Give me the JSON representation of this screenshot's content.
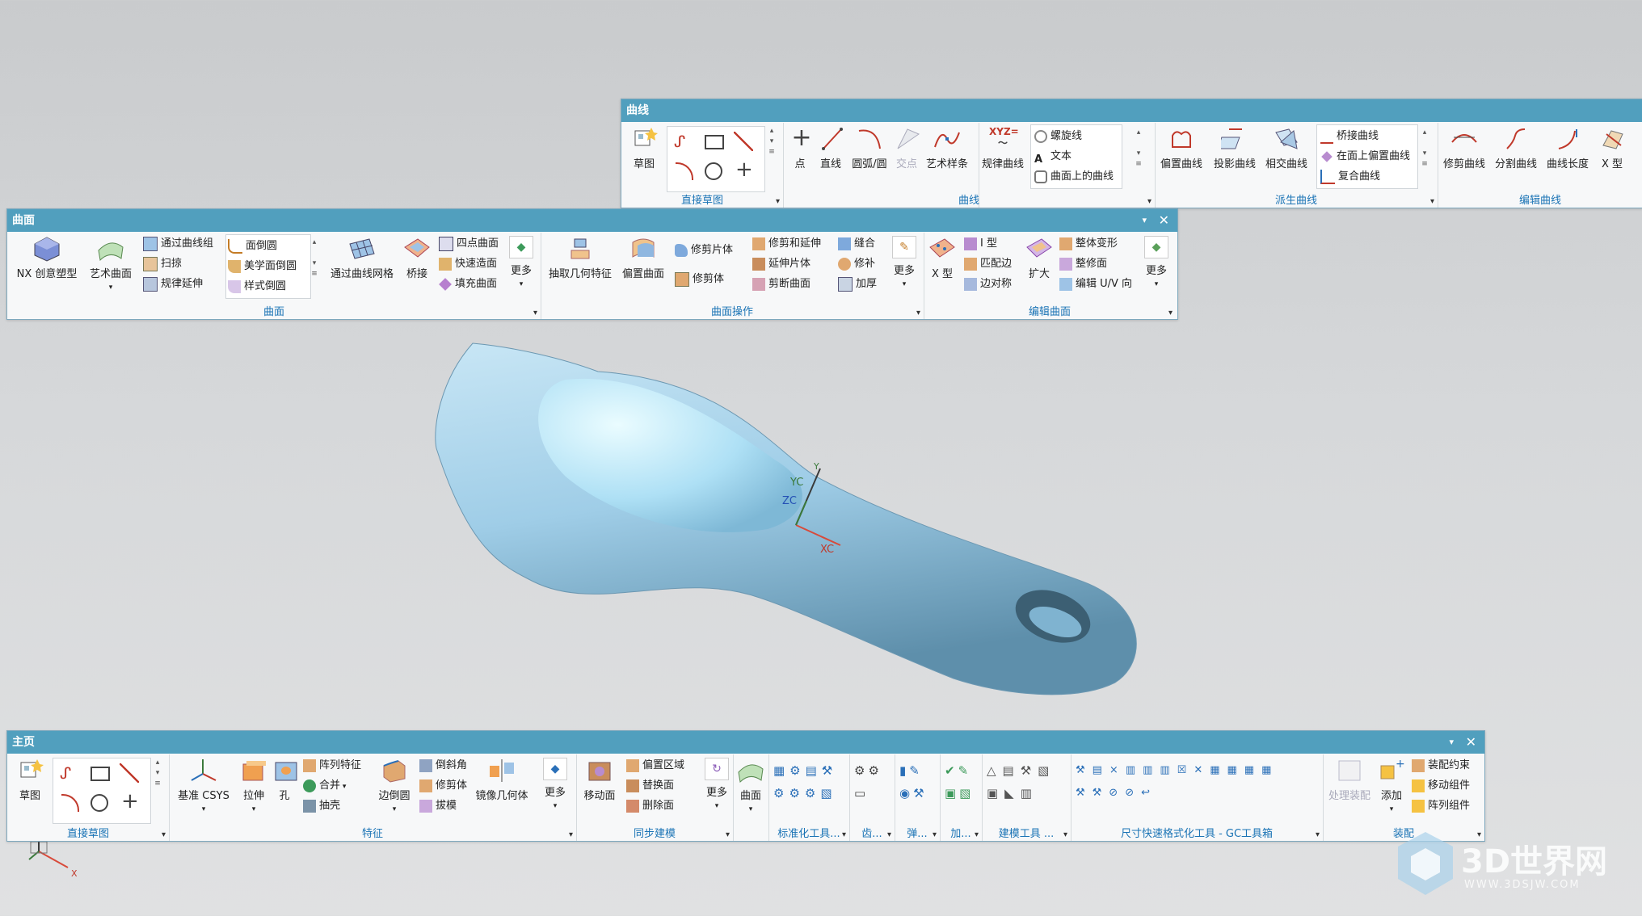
{
  "colors": {
    "accent": "#519fbe",
    "group_label": "#1a73b5",
    "part": "#9fcde7"
  },
  "curve_panel": {
    "title": "曲线",
    "sketch_group": {
      "label": "直接草图",
      "sketch_btn": "草图"
    },
    "curve_group": {
      "label": "曲线",
      "buttons": [
        "点",
        "直线",
        "圆弧/圆",
        "交点",
        "艺术样条",
        "规律曲线"
      ],
      "xyz_text": "XYZ=",
      "list": [
        "螺旋线",
        "文本",
        "曲面上的曲线"
      ]
    },
    "derived_group": {
      "label": "派生曲线",
      "buttons": [
        "偏置曲线",
        "投影曲线",
        "相交曲线"
      ],
      "list": [
        "桥接曲线",
        "在面上偏置曲线",
        "复合曲线"
      ]
    },
    "edit_group": {
      "label": "编辑曲线",
      "buttons": [
        "修剪曲线",
        "分割曲线",
        "曲线长度",
        "X 型"
      ]
    }
  },
  "surface_panel": {
    "title": "曲面",
    "surface_group": {
      "label": "曲面",
      "big": [
        "NX 创意塑型",
        "艺术曲面"
      ],
      "list1": [
        "通过曲线组",
        "扫掠",
        "规律延伸"
      ],
      "gallery": [
        "面倒圆",
        "美学面倒圆",
        "样式倒圆"
      ],
      "big2": [
        "通过曲线网格",
        "桥接"
      ],
      "list2": [
        "四点曲面",
        "快速造面",
        "填充曲面"
      ],
      "more": "更多"
    },
    "op_group": {
      "label": "曲面操作",
      "big": [
        "抽取几何特征",
        "偏置曲面"
      ],
      "list1": [
        "修剪片体",
        "修剪体"
      ],
      "list2": [
        "修剪和延伸",
        "延伸片体",
        "剪断曲面"
      ],
      "list3": [
        "缝合",
        "修补",
        "加厚"
      ],
      "more": "更多"
    },
    "edit_group": {
      "label": "编辑曲面",
      "big": [
        "X 型"
      ],
      "list1": [
        "I 型",
        "匹配边",
        "边对称"
      ],
      "big2": [
        "扩大"
      ],
      "list2": [
        "整体变形",
        "整修面",
        "编辑 U/V 向"
      ],
      "more": "更多"
    }
  },
  "home_panel": {
    "title": "主页",
    "sketch_group": {
      "label": "直接草图",
      "sketch_btn": "草图"
    },
    "feature_group": {
      "label": "特征",
      "big": [
        "基准 CSYS",
        "拉伸",
        "孔"
      ],
      "list1": [
        "阵列特征",
        "合并",
        "抽壳"
      ],
      "big2": [
        "边倒圆"
      ],
      "list2": [
        "倒斜角",
        "修剪体",
        "拔模"
      ],
      "big3": [
        "镜像几何体"
      ],
      "more": "更多"
    },
    "sync_group": {
      "label": "同步建模",
      "big": [
        "移动面"
      ],
      "list": [
        "偏置区域",
        "替换面",
        "删除面"
      ],
      "more": "更多"
    },
    "surface_group": {
      "label": "",
      "big": [
        "曲面"
      ]
    },
    "std_group": {
      "label": "标准化工具..."
    },
    "gear_group": {
      "label": "齿..."
    },
    "spring_group": {
      "label": "弹..."
    },
    "add_group": {
      "label": "加..."
    },
    "model_group": {
      "label": "建模工具 ..."
    },
    "gc_group": {
      "label": "尺寸快速格式化工具 - GC工具箱"
    },
    "assembly_group": {
      "label": "装配",
      "big": [
        "处理装配",
        "添加"
      ],
      "list": [
        "装配约束",
        "移动组件",
        "阵列组件"
      ]
    }
  },
  "viewport": {
    "triad_labels": [
      "YC",
      "ZC",
      "XC",
      "Y"
    ],
    "mini_axis_label": "X"
  },
  "watermark": {
    "text": "3D世界网",
    "url": "WWW.3DSJW.COM"
  }
}
